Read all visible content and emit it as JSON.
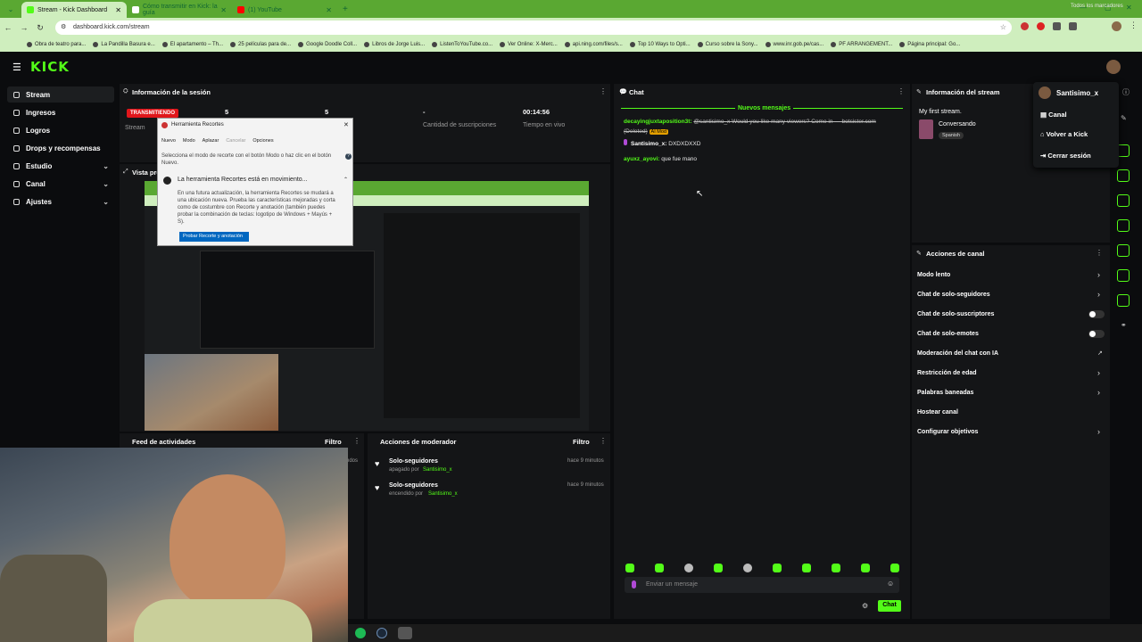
{
  "browser": {
    "tabs": [
      {
        "title": "Stream - Kick Dashboard",
        "icon": "kick-tab-icon",
        "color": "#53fc18"
      },
      {
        "title": "Cómo transmitir en Kick: la guía",
        "icon": "doc-tab-icon",
        "color": "#ffffff"
      },
      {
        "title": "(1) YouTube",
        "icon": "youtube-tab-icon",
        "color": "#ff0000"
      }
    ],
    "url": "dashboard.kick.com/stream",
    "bookmarks": [
      "Obra de teatro para...",
      "La Pandilla Basura e...",
      "El apartamento – Th...",
      "25 películas para de...",
      "Google Doodle Coll...",
      "Libros de Jorge Luis...",
      "ListenToYouTube.co...",
      "Ver Online: X-Merc...",
      "api.ning.com/files/s...",
      "Top 10 Ways to Opti...",
      "Curso sobre la Sony...",
      "www.inr.gob.pe/cas...",
      "PF ARRANGEMENT...",
      "Página principal: Go..."
    ],
    "all_bookmarks": "Todos los marcadores"
  },
  "kick": {
    "logo": "KICK",
    "user": "Santisimo_x",
    "sidebar": [
      {
        "label": "Stream",
        "icon": "stream-icon",
        "chevron": false
      },
      {
        "label": "Ingresos",
        "icon": "income-icon",
        "chevron": false
      },
      {
        "label": "Logros",
        "icon": "achievements-icon",
        "chevron": false
      },
      {
        "label": "Drops y recompensas",
        "icon": "drops-icon",
        "chevron": false
      },
      {
        "label": "Estudio",
        "icon": "studio-icon",
        "chevron": true
      },
      {
        "label": "Canal",
        "icon": "channel-icon",
        "chevron": true
      },
      {
        "label": "Ajustes",
        "icon": "settings-icon",
        "chevron": true
      }
    ],
    "session": {
      "title": "Información de la sesión",
      "status": "TRANSMITIENDO",
      "stream_label": "Stream",
      "viewers": "5",
      "followers": "5",
      "subs_value": "-",
      "subs_label": "Cantidad de suscripciones",
      "time": "00:14:56",
      "time_label": "Tiempo en vivo"
    },
    "preview_title": "Vista previa",
    "activity": {
      "title": "Feed de actividades",
      "filter": "Filtro",
      "partial_text": "ndos"
    },
    "mod_actions": {
      "title": "Acciones de moderador",
      "filter": "Filtro",
      "items": [
        {
          "title": "Solo-seguidores",
          "action": "apagado por",
          "user": "Santisimo_x",
          "time": "hace 9 minutos"
        },
        {
          "title": "Solo-seguidores",
          "action": "encendido por",
          "user": "Santisimo_x",
          "time": "hace 9 minutos"
        }
      ]
    },
    "chat": {
      "title": "Chat",
      "new_messages": "Nuevos mensajes",
      "messages": [
        {
          "user": "decayingjuxtaposition3t:",
          "text": "@santisimo_x Would you like many viewers? Come in — botsister.com (Deleted)",
          "tag": "AI Mod"
        },
        {
          "user": "Santisimo_x:",
          "text": "DXDXDXXD",
          "tag": ""
        },
        {
          "user": "ayuxz_ayovi:",
          "text": "que fue mano",
          "tag": ""
        }
      ],
      "placeholder": "Enviar un mensaje",
      "send": "Chat"
    },
    "stream_info": {
      "title": "Información del stream",
      "stream_title": "My first stream.",
      "category": "Conversando",
      "language": "Spanish"
    },
    "channel_actions": {
      "title": "Acciones de canal",
      "items": [
        {
          "label": "Modo lento",
          "control": "chevron"
        },
        {
          "label": "Chat de solo-seguidores",
          "control": "chevron"
        },
        {
          "label": "Chat de solo-suscriptores",
          "control": "toggle"
        },
        {
          "label": "Chat de solo-emotes",
          "control": "toggle"
        },
        {
          "label": "Moderación del chat con IA",
          "control": "external"
        },
        {
          "label": "Restricción de edad",
          "control": "chevron"
        },
        {
          "label": "Palabras baneadas",
          "control": "chevron"
        },
        {
          "label": "Hostear canal",
          "control": "none"
        },
        {
          "label": "Configurar objetivos",
          "control": "chevron"
        }
      ]
    },
    "user_menu": [
      "Canal",
      "Volver a Kick",
      "Cerrar sesión"
    ]
  },
  "snipping_tool": {
    "title": "Herramienta Recortes",
    "toolbar": [
      "Nuevo",
      "Modo",
      "Aplazar",
      "Cancelar",
      "Opciones"
    ],
    "hint": "Selecciona el modo de recorte con el botón Modo o haz clic en el botón Nuevo.",
    "notice_title": "La herramienta Recortes está en movimiento...",
    "notice_body": "En una futura actualización, la herramienta Recortes se mudará a una ubicación nueva. Prueba las características mejoradas y corta como de costumbre con Recorte y anotación (también puedes probar la combinación de teclas: logotipo de Windows + Mayús + S).",
    "button": "Probar Recorte y anotación"
  },
  "colors": {
    "accent": "#53fc18",
    "live": "#e0161b",
    "panel": "#141517"
  }
}
